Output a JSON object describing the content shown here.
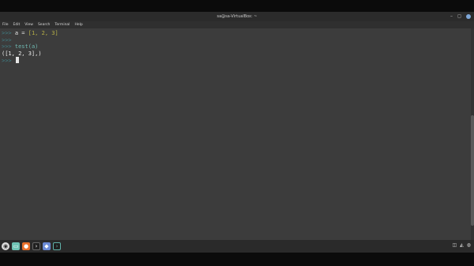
{
  "window": {
    "title": "sa@sa-VirtualBox: ~"
  },
  "menu": {
    "items": [
      "File",
      "Edit",
      "View",
      "Search",
      "Terminal",
      "Help"
    ]
  },
  "terminal": {
    "prompt": ">>>",
    "line1_var": "a",
    "line1_op": " = ",
    "line1_list": "[1, 2, 3]",
    "line3_cmd": "test(a)",
    "output": "([1, 2, 3],)"
  },
  "icons": {
    "menu": "menu-icon",
    "files": "files-icon",
    "firefox": "firefox-icon",
    "terminal": "terminal-icon",
    "settings": "settings-icon",
    "terminal2": "terminal-icon"
  }
}
